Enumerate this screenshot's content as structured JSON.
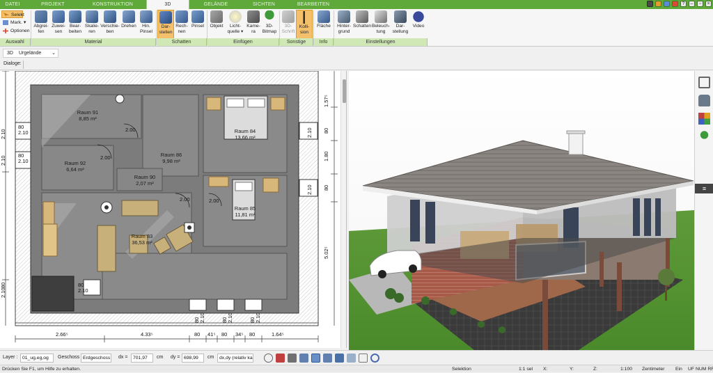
{
  "menu": {
    "tabs": [
      "DATEI",
      "PROJEKT",
      "KONSTRUKTION",
      "3D",
      "GELÄNDE",
      "SICHTEN",
      "BEARBEITEN"
    ],
    "active_tab": "3D"
  },
  "ribbon": {
    "auswahl": {
      "selekt": "Selekt",
      "mark": "Mark.",
      "optionen": "Optionen",
      "group": "Auswahl"
    },
    "material": {
      "buttons": [
        {
          "l1": "Abgrei-",
          "l2": "fen"
        },
        {
          "l1": "Zuwei-",
          "l2": "sen"
        },
        {
          "l1": "Bear-",
          "l2": "beiten"
        },
        {
          "l1": "Skalie-",
          "l2": "ren"
        },
        {
          "l1": "Verschie-",
          "l2": "ben"
        },
        {
          "l1": "Drehen",
          "l2": ""
        },
        {
          "l1": "Hin.",
          "l2": "Pinsel"
        }
      ],
      "group": "Material"
    },
    "schatten": {
      "buttons": [
        {
          "l1": "Dar-",
          "l2": "stellen"
        },
        {
          "l1": "Rech-",
          "l2": "nen"
        },
        {
          "l1": "Pinsel",
          "l2": ""
        }
      ],
      "group": "Schatten"
    },
    "einfuegen": {
      "buttons": [
        {
          "l1": "Objekt",
          "l2": ""
        },
        {
          "l1": "Licht-",
          "l2": "quelle ▾"
        },
        {
          "l1": "Kame-",
          "l2": "ra"
        },
        {
          "l1": "3D-",
          "l2": "Bitmap"
        }
      ],
      "group": "Einfügen"
    },
    "sonstige": {
      "buttons": [
        {
          "l1": "3D-",
          "l2": "Schrift"
        },
        {
          "l1": "Kolli-",
          "l2": "sion"
        }
      ],
      "group": "Sonstige"
    },
    "info": {
      "buttons": [
        {
          "l1": "Fläche",
          "l2": ""
        }
      ],
      "group": "Info"
    },
    "einstellungen": {
      "buttons": [
        {
          "l1": "Hinter-",
          "l2": "grund"
        },
        {
          "l1": "Schatten",
          "l2": ""
        },
        {
          "l1": "Beleuch-",
          "l2": "tung"
        },
        {
          "l1": "Dar-",
          "l2": "stellung"
        },
        {
          "l1": "Video",
          "l2": ""
        }
      ],
      "group": "Einstellungen"
    }
  },
  "toolbar": {
    "view_mode": "3D",
    "view_name": "Urgelände",
    "dialoge_label": "Dialoge:"
  },
  "plan": {
    "rooms": [
      {
        "name": "Raum 91",
        "area": "8,85 m²"
      },
      {
        "name": "Raum 92",
        "area": "6,64 m²"
      },
      {
        "name": "Raum 86",
        "area": "9,98 m²"
      },
      {
        "name": "Raum 90",
        "area": "2,07 m²"
      },
      {
        "name": "Raum 83",
        "area": "36,53 m²"
      },
      {
        "name": "Raum 84",
        "area": "13,66 m²"
      },
      {
        "name": "Raum 85",
        "area": "11,81 m²"
      }
    ],
    "door_labels": [
      "2.00",
      "2.00",
      "2.00",
      "2.00"
    ],
    "left_dims": [
      "80",
      "2.10",
      "2.10",
      "80",
      "2.10",
      "2.10",
      "80",
      "2.10",
      "2.10",
      "80"
    ],
    "right_dims": [
      "1.57⁵",
      "80",
      "2.10",
      "1.80",
      "80",
      "2.10",
      "5.02⁵"
    ],
    "bottom_dims": [
      "2.66⁵",
      "4.33⁵",
      "80",
      "41⁵",
      "80",
      "34⁵",
      "80",
      "1.64⁵"
    ],
    "bottom_window_labels": [
      "80",
      "2.10",
      "80",
      "2.10",
      "80",
      "2.10"
    ],
    "inner_label": "80\n2.10"
  },
  "coordbar": {
    "layer_label": "Layer :",
    "layer_value": "01_ug,eg,og",
    "geschoss_label": "Geschoss :",
    "geschoss_value": "Erdgeschoss",
    "dx_label": "dx =",
    "dx_value": "701,97",
    "dx_unit": "cm",
    "dy_label": "dy =",
    "dy_value": "698,99",
    "dy_unit": "cm",
    "mode_value": "dx,dy (relativ kar"
  },
  "status": {
    "help": "Drücken Sie F1, um Hilfe zu erhalten.",
    "mode": "Selektion",
    "sel": "1:1 sel",
    "x": "X:",
    "y": "Y:",
    "z": "Z:",
    "scale": "1:100",
    "unit": "Zentimeter",
    "ein": "Ein",
    "keys": "UF NUM RF"
  },
  "colors": {
    "menu_green": "#5fa83a",
    "active_orange": "#f4c06b",
    "group_green": "#cfe8b6"
  }
}
